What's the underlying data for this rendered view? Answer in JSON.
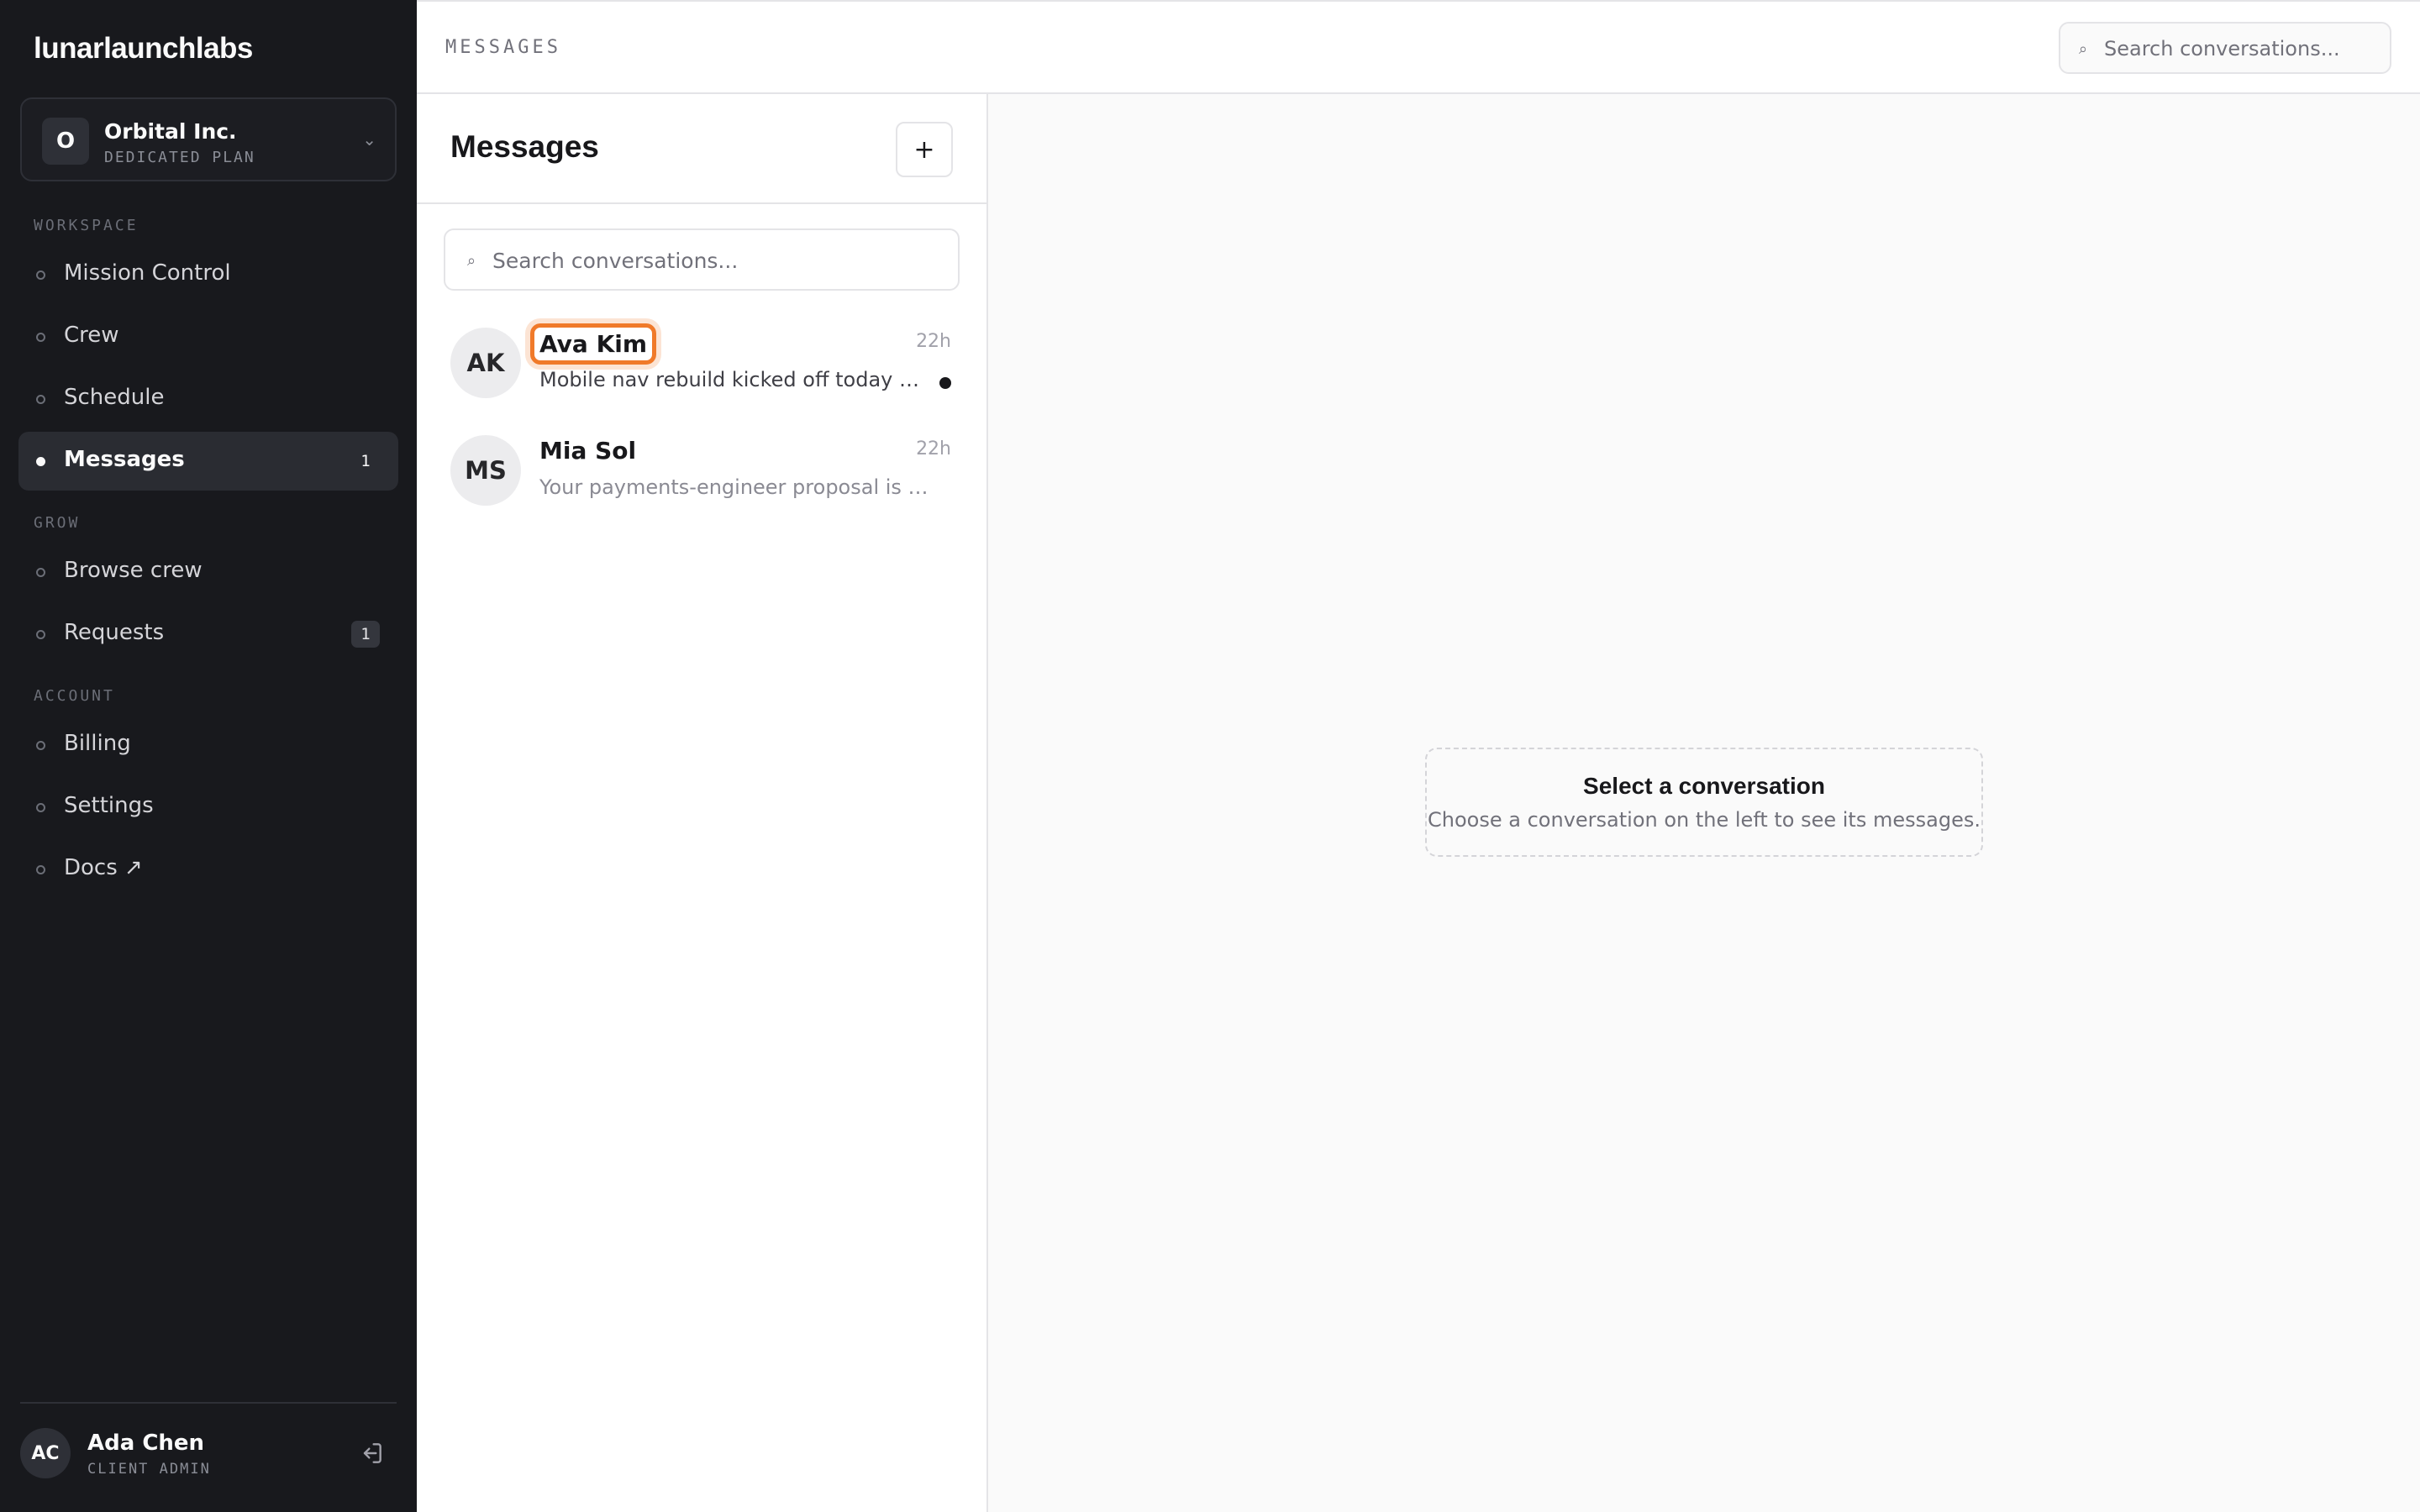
{
  "brand": "lunarlaunchlabs",
  "org": {
    "initial": "O",
    "name": "Orbital Inc.",
    "plan": "DEDICATED PLAN"
  },
  "sections": {
    "workspace": "WORKSPACE",
    "grow": "GROW",
    "account": "ACCOUNT"
  },
  "nav": {
    "mission_control": "Mission Control",
    "crew": "Crew",
    "schedule": "Schedule",
    "messages": "Messages",
    "messages_badge": "1",
    "browse_crew": "Browse crew",
    "requests": "Requests",
    "requests_badge": "1",
    "billing": "Billing",
    "settings": "Settings",
    "docs": "Docs ↗"
  },
  "user": {
    "initials": "AC",
    "name": "Ada Chen",
    "role": "CLIENT ADMIN"
  },
  "topbar": {
    "breadcrumb": "MESSAGES",
    "search_placeholder": "Search conversations..."
  },
  "conversations": {
    "title": "Messages",
    "new_label": "+",
    "search_placeholder": "Search conversations...",
    "items": [
      {
        "initials": "AK",
        "name": "Ava Kim",
        "time": "22h",
        "preview": "Mobile nav rebuild kicked off today — b...",
        "unread": true
      },
      {
        "initials": "MS",
        "name": "Mia Sol",
        "time": "22h",
        "preview": "Your payments-engineer proposal is read...",
        "unread": false
      }
    ]
  },
  "empty_state": {
    "title": "Select a conversation",
    "subtitle": "Choose a conversation on the left to see its messages."
  },
  "colors": {
    "sidebar_bg": "#18191d",
    "highlight": "#f07a2a"
  }
}
